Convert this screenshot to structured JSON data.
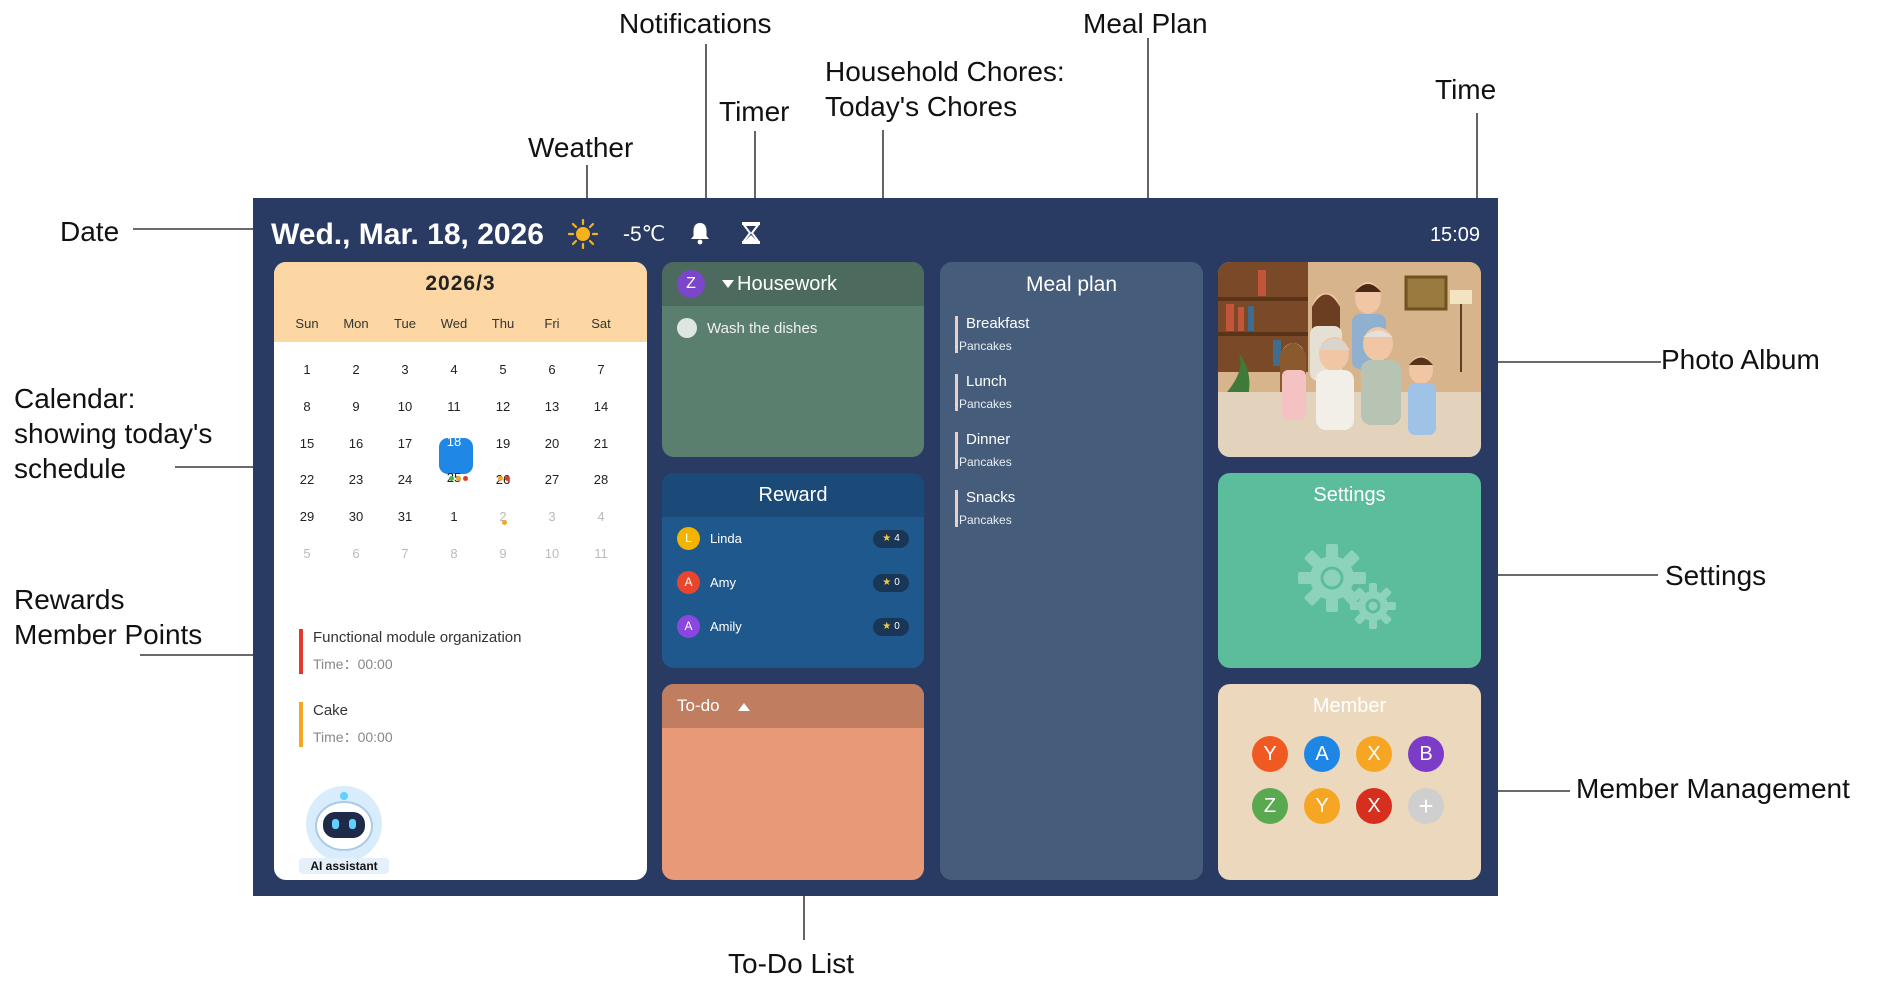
{
  "callouts": {
    "notifications": "Notifications",
    "meal_plan": "Meal Plan",
    "household_chores": "Household Chores:\nToday's Chores",
    "time": "Time",
    "timer": "Timer",
    "weather": "Weather",
    "date": "Date",
    "calendar": "Calendar:\nshowing today's\nschedule",
    "photo_album": "Photo Album",
    "settings": "Settings",
    "rewards": "Rewards\nMember Points",
    "member_management": "Member Management",
    "todo_list": "To-Do List"
  },
  "header": {
    "date": "Wed., Mar. 18, 2026",
    "weather_icon": "sun-icon",
    "temperature": "-5℃",
    "notifications_icon": "bell-icon",
    "timer_icon": "hourglass-icon",
    "time": "15:09"
  },
  "calendar": {
    "title": "2026/3",
    "weekdays": [
      "Sun",
      "Mon",
      "Tue",
      "Wed",
      "Thu",
      "Fri",
      "Sat"
    ],
    "weeks": [
      [
        "1",
        "2",
        "3",
        "4",
        "5",
        "6",
        "7"
      ],
      [
        "8",
        "9",
        "10",
        "11",
        "12",
        "13",
        "14"
      ],
      [
        "15",
        "16",
        "17",
        "18",
        "19",
        "20",
        "21"
      ],
      [
        "22",
        "23",
        "24",
        "25",
        "26",
        "27",
        "28"
      ],
      [
        "29",
        "30",
        "31",
        "1",
        "2",
        "3",
        "4"
      ],
      [
        "5",
        "6",
        "7",
        "8",
        "9",
        "10",
        "11"
      ]
    ],
    "today": "18",
    "events": [
      {
        "title": "Functional module organization",
        "time": "Time：00:00",
        "color": "#e5382c"
      },
      {
        "title": "Cake",
        "time": "Time：00:00",
        "color": "#f5a623"
      }
    ],
    "ai_label": "AI assistant"
  },
  "housework": {
    "avatar": "Z",
    "title": "Housework",
    "chores": [
      "Wash the dishes"
    ]
  },
  "reward": {
    "title": "Reward",
    "members": [
      {
        "initial": "L",
        "name": "Linda",
        "points": "4",
        "color": "#f5b301"
      },
      {
        "initial": "A",
        "name": "Amy",
        "points": "0",
        "color": "#e8452c"
      },
      {
        "initial": "A",
        "name": "Amily",
        "points": "0",
        "color": "#8c46e0"
      }
    ]
  },
  "todo": {
    "title": "To-do"
  },
  "meal_plan": {
    "title": "Meal plan",
    "sections": [
      {
        "name": "Breakfast",
        "item": "·Pancakes"
      },
      {
        "name": "Lunch",
        "item": "·Pancakes"
      },
      {
        "name": "Dinner",
        "item": "·Pancakes"
      },
      {
        "name": "Snacks",
        "item": "·Pancakes"
      }
    ]
  },
  "settings": {
    "title": "Settings",
    "icon": "gear-icon"
  },
  "members": {
    "title": "Member",
    "list": [
      {
        "initial": "Y",
        "color": "#f05a22"
      },
      {
        "initial": "A",
        "color": "#1e87e5"
      },
      {
        "initial": "X",
        "color": "#f6a623"
      },
      {
        "initial": "B",
        "color": "#7b3cc8"
      },
      {
        "initial": "Z",
        "color": "#5aa84f"
      },
      {
        "initial": "Y",
        "color": "#f6a623"
      },
      {
        "initial": "X",
        "color": "#d72f1e"
      }
    ],
    "add_label": "+"
  }
}
